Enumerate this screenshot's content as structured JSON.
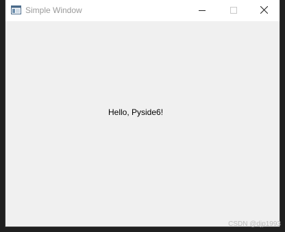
{
  "window": {
    "title": "Simple Window",
    "app_icon": "window-app-icon",
    "controls": {
      "minimize_icon": "minimize-icon",
      "maximize_icon": "maximize-icon",
      "close_icon": "close-icon"
    }
  },
  "content": {
    "label": "Hello, Pyside6!"
  },
  "watermark": "CSDN @djp1993",
  "colors": {
    "titlebar_bg": "#ffffff",
    "client_bg": "#f0f0f0",
    "title_text": "#9a9a9a",
    "desktop_bg": "#202020"
  }
}
